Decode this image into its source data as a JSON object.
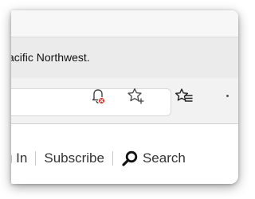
{
  "browser": {
    "page_title": "acific Northwest.",
    "icons": {
      "notifications": "bell-icon",
      "notification_badge_color": "#d93025",
      "add_favorite": "star-plus-icon",
      "favorites": "star-list-icon",
      "more": "more-icon"
    }
  },
  "site_nav": {
    "login_label": "g In",
    "subscribe_label": "Subscribe",
    "search_label": "Search",
    "search_icon": "search-icon"
  }
}
